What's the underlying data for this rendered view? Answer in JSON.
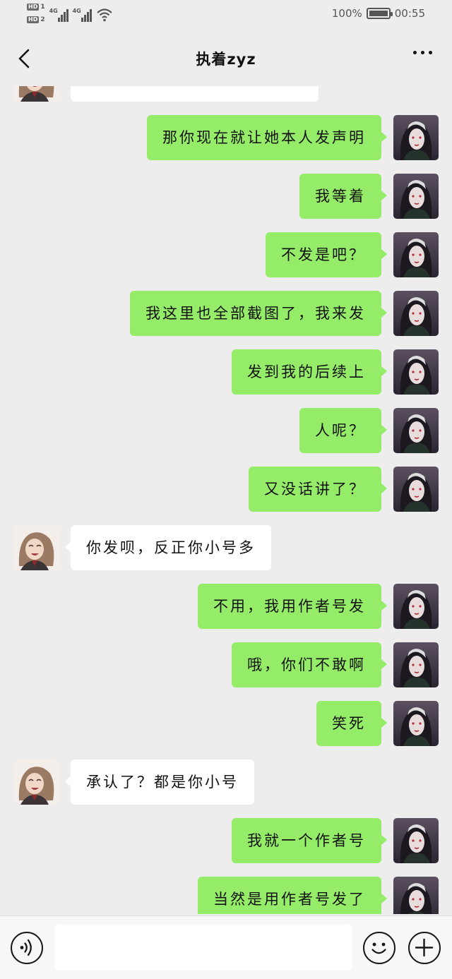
{
  "status_bar": {
    "sim1": "HD",
    "sim1_num": "1",
    "sim2": "HD",
    "sim2_num": "2",
    "net1": "4G",
    "net2": "4G",
    "battery_percent": "100%",
    "time": "00:55"
  },
  "header": {
    "title": "执着zyz"
  },
  "messages": [
    {
      "side": "other",
      "text": ""
    },
    {
      "side": "me",
      "text": "那你现在就让她本人发声明"
    },
    {
      "side": "me",
      "text": "我等着"
    },
    {
      "side": "me",
      "text": "不发是吧？"
    },
    {
      "side": "me",
      "text": "我这里也全部截图了，我来发"
    },
    {
      "side": "me",
      "text": "发到我的后续上"
    },
    {
      "side": "me",
      "text": "人呢？"
    },
    {
      "side": "me",
      "text": "又没话讲了？"
    },
    {
      "side": "other",
      "text": "你发呗，反正你小号多"
    },
    {
      "side": "me",
      "text": "不用，我用作者号发"
    },
    {
      "side": "me",
      "text": "哦，你们不敢啊"
    },
    {
      "side": "me",
      "text": "笑死"
    },
    {
      "side": "other",
      "text": "承认了？都是你小号"
    },
    {
      "side": "me",
      "text": "我就一个作者号"
    },
    {
      "side": "me",
      "text": "当然是用作者号发了"
    }
  ],
  "input_bar": {
    "placeholder": "",
    "voice_icon": "voice-icon",
    "emoji_icon": "emoji-icon",
    "plus_icon": "plus-icon"
  },
  "colors": {
    "background": "#ededed",
    "my_bubble": "#95ec69",
    "other_bubble": "#ffffff"
  }
}
